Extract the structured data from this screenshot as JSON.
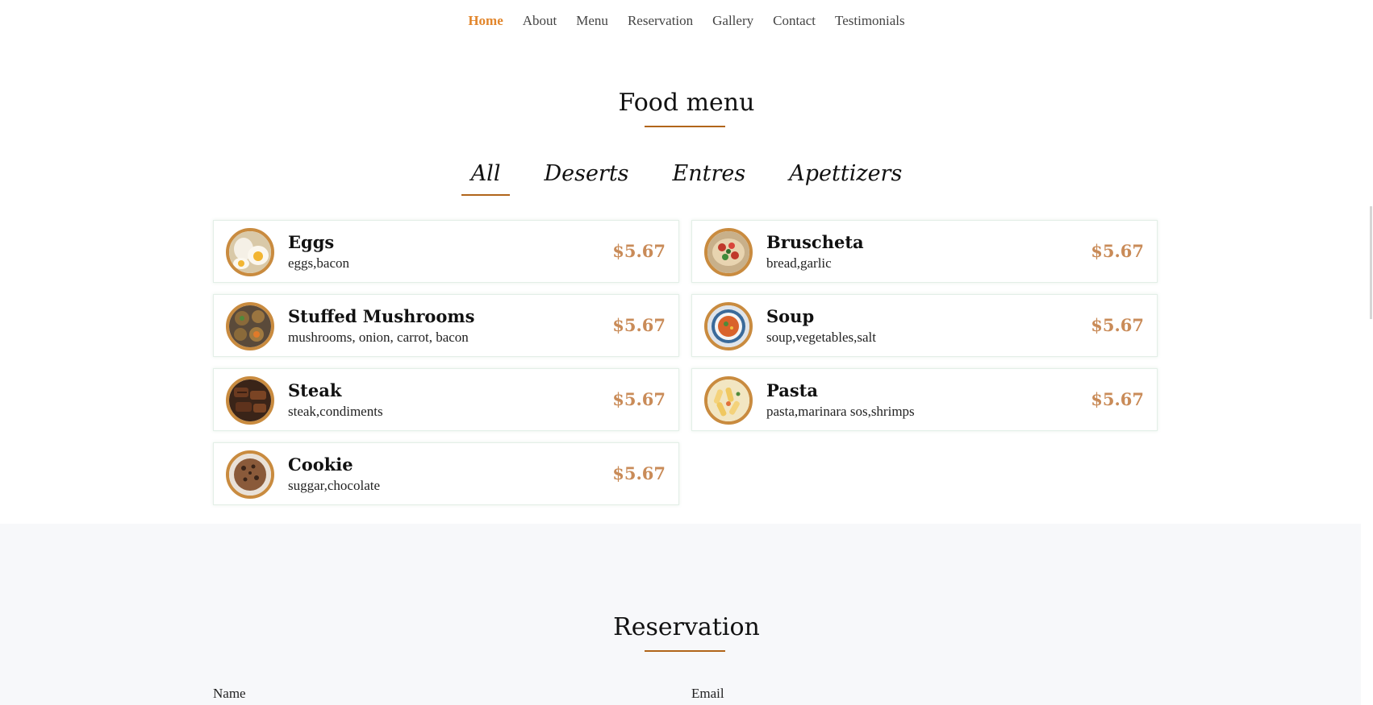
{
  "nav": {
    "items": [
      {
        "label": "Home",
        "active": true
      },
      {
        "label": "About"
      },
      {
        "label": "Menu"
      },
      {
        "label": "Reservation"
      },
      {
        "label": "Gallery"
      },
      {
        "label": "Contact"
      },
      {
        "label": "Testimonials"
      }
    ]
  },
  "food_menu": {
    "title": "Food menu",
    "tabs": [
      "All",
      "Deserts",
      "Entres",
      "Apettizers"
    ],
    "active_tab": "All",
    "items": [
      {
        "name": "Eggs",
        "desc": "eggs,bacon",
        "price": "$5.67",
        "icon": "eggs-photo"
      },
      {
        "name": "Bruscheta",
        "desc": "bread,garlic",
        "price": "$5.67",
        "icon": "bruschetta-photo"
      },
      {
        "name": "Stuffed Mushrooms",
        "desc": "mushrooms, onion, carrot, bacon",
        "price": "$5.67",
        "icon": "stuffed-mushrooms-photo"
      },
      {
        "name": "Soup",
        "desc": "soup,vegetables,salt",
        "price": "$5.67",
        "icon": "soup-photo"
      },
      {
        "name": "Steak",
        "desc": "steak,condiments",
        "price": "$5.67",
        "icon": "steak-photo"
      },
      {
        "name": "Pasta",
        "desc": "pasta,marinara sos,shrimps",
        "price": "$5.67",
        "icon": "pasta-photo"
      },
      {
        "name": "Cookie",
        "desc": "suggar,chocolate",
        "price": "$5.67",
        "icon": "cookie-photo"
      }
    ]
  },
  "reservation": {
    "title": "Reservation",
    "name_label": "Name",
    "email_label": "Email"
  },
  "colors": {
    "accent": "#e2862c",
    "underline": "#b1651a",
    "price": "#c98b58",
    "thumb_border": "#c98b3f"
  }
}
